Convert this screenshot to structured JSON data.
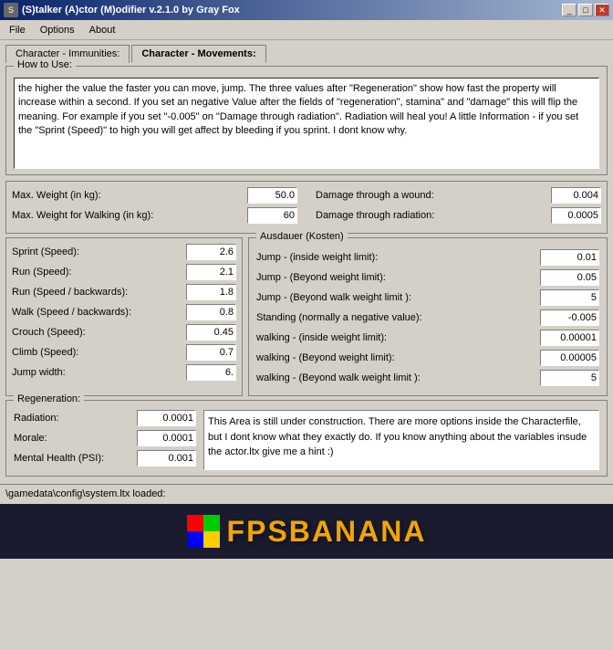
{
  "window": {
    "title": "(S)talker (A)ctor (M)odifier v.2.1.0 by Gray Fox",
    "icon": "S"
  },
  "menu": {
    "items": [
      "File",
      "Options",
      "About"
    ]
  },
  "tabs": {
    "tab1": "Character - Immunities:",
    "tab2": "Character - Movements:"
  },
  "howToUse": {
    "legend": "How to Use:",
    "text": "the higher the value the faster you can move, jump. The three values after \"Regeneration\" show how fast the property will increase within a second.  If you set an negative Value after the fields of \"regeneration\", stamina\" and \"damage\" this will flip the meaning. For example if you set \"-0.005\" on \"Damage through radiation\". Radiation will heal you! A little Information - if you set the \"Sprint (Speed)\" to high you will get affect by bleeding if you sprint. I dont know why."
  },
  "topForm": {
    "maxWeight": {
      "label": "Max. Weight (in kg):",
      "value": "50.0"
    },
    "maxWeightWalking": {
      "label": "Max. Weight for Walking (in kg):",
      "value": "60"
    },
    "damageThroughWound": {
      "label": "Damage through a wound:",
      "value": "0.004"
    },
    "damageThroughRadiation": {
      "label": "Damage through radiation:",
      "value": "0.0005"
    }
  },
  "movementFields": {
    "sprint": {
      "label": "Sprint (Speed):",
      "value": "2.6"
    },
    "run": {
      "label": "Run (Speed):",
      "value": "2.1"
    },
    "runBackwards": {
      "label": "Run (Speed / backwards):",
      "value": "1.8"
    },
    "walk": {
      "label": "Walk (Speed / backwards):",
      "value": "0.8"
    },
    "crouch": {
      "label": "Crouch (Speed):",
      "value": "0.45"
    },
    "climb": {
      "label": "Climb (Speed):",
      "value": "0.7"
    },
    "jumpWidth": {
      "label": "Jump width:",
      "value": "6."
    }
  },
  "ausdauer": {
    "legend": "Ausdauer (Kosten)",
    "jumpInside": {
      "label": "Jump - (inside weight limit):",
      "value": "0.01"
    },
    "jumpBeyond": {
      "label": "Jump - (Beyond weight limit):",
      "value": "0.05"
    },
    "jumpBeyondWalk": {
      "label": "Jump - (Beyond walk weight limit ):",
      "value": "5"
    },
    "standing": {
      "label": "Standing (normally a negative value):",
      "value": "-0.005"
    },
    "walkingInside": {
      "label": "walking - (inside weight limit):",
      "value": "0.00001"
    },
    "walkingBeyond": {
      "label": "walking - (Beyond weight limit):",
      "value": "0.00005"
    },
    "walkingBeyondWalk": {
      "label": "walking - (Beyond walk weight limit ):",
      "value": "5"
    }
  },
  "regeneration": {
    "legend": "Regeneration:",
    "radiation": {
      "label": "Radiation:",
      "value": "0.0001"
    },
    "morale": {
      "label": "Morale:",
      "value": "0.0001"
    },
    "mentalHealth": {
      "label": "Mental Health (PSI):",
      "value": "0.001"
    },
    "note": "This Area is still under construction. There are more options inside the Characterfile, but I dont know what they exactly do. If you know anything about the variables insude the actor.ltx give me a hint :)"
  },
  "statusBar": {
    "text": "\\gamedata\\config\\system.ltx loaded:"
  },
  "footer": {
    "logoText": "FPSBANANA"
  }
}
